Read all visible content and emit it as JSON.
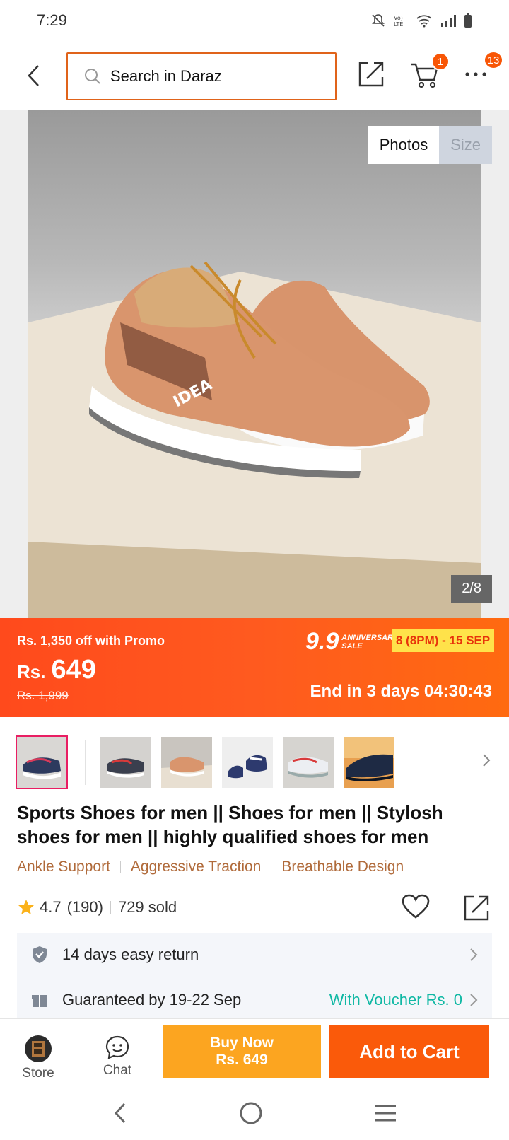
{
  "status": {
    "time": "7:29"
  },
  "header": {
    "search_placeholder": "Search in Daraz",
    "cart_count": "1",
    "more_count": "13"
  },
  "gallery": {
    "tabs": [
      "Photos",
      "Size"
    ],
    "counter": "2/8",
    "brand_print": "IDEA"
  },
  "promo": {
    "off_text": "Rs. 1,350 off with Promo",
    "currency": "Rs.",
    "price": "649",
    "old_price": "Rs. 1,999",
    "sale_logo": "9.9",
    "sale_sub1": "ANNIVERSARY",
    "sale_sub2": "SALE",
    "sale_date": "8 (8PM) - 15 SEP",
    "countdown": "End in 3 days 04:30:43"
  },
  "product": {
    "title": "Sports Shoes for men || Shoes for men || Stylosh shoes for men || highly qualified shoes for men",
    "features": [
      "Ankle Support",
      "Aggressive Traction",
      "Breathable Design"
    ],
    "rating": "4.7",
    "reviews": "(190)",
    "sold": "729 sold"
  },
  "info": {
    "return": "14 days easy return",
    "delivery": "Guaranteed by 19-22 Sep",
    "voucher": "With Voucher Rs. 0"
  },
  "bottom": {
    "store": "Store",
    "chat": "Chat",
    "buy_now": "Buy Now",
    "buy_price": "Rs. 649",
    "add_to_cart": "Add to Cart"
  },
  "colors": {
    "brand": "#f85606",
    "buy_now": "#fca520",
    "voucher": "#10b8a4"
  }
}
